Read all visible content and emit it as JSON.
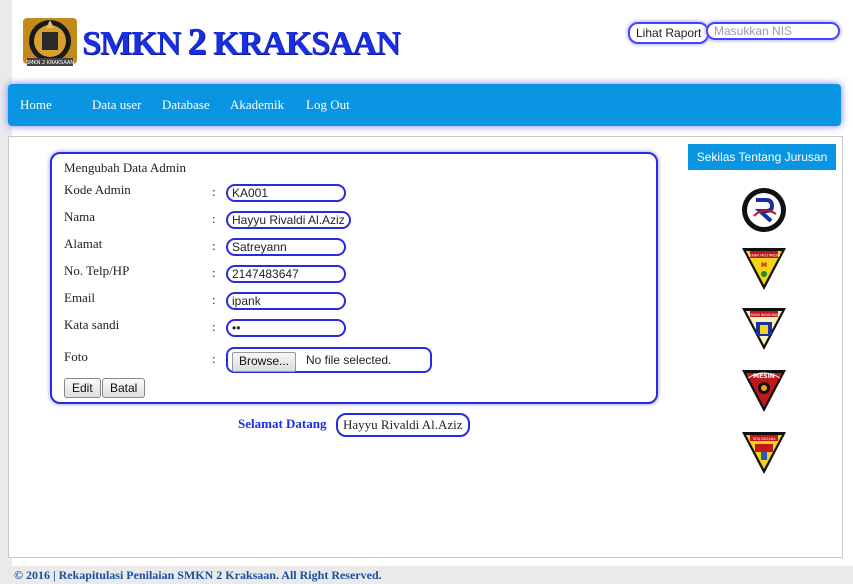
{
  "header": {
    "brand": "SMKN 2 KRAKSAAN",
    "brand_prefix": "SMKN ",
    "brand_number": "2",
    "brand_suffix": " KRAKSAAN",
    "raport_button": "Lihat Raport",
    "nis_placeholder": "Masukkan NIS"
  },
  "nav": {
    "items": [
      "Home",
      "Data user",
      "Database",
      "Akademik",
      "Log Out"
    ]
  },
  "form": {
    "title": "Mengubah Data Admin",
    "fields": [
      {
        "label": "Kode Admin",
        "value": "KA001"
      },
      {
        "label": "Nama",
        "value": "Hayyu Rivaldi Al.Aziz"
      },
      {
        "label": "Alamat",
        "value": "Satreyann"
      },
      {
        "label": "No. Telp/HP",
        "value": "2147483647"
      },
      {
        "label": "Email",
        "value": "ipank"
      },
      {
        "label": "Kata sandi",
        "value": "••"
      },
      {
        "label": "Foto",
        "value": ""
      }
    ],
    "colon": ":",
    "browse_label": "Browse...",
    "file_status": "No file selected.",
    "edit_label": "Edit",
    "cancel_label": "Batal"
  },
  "welcome": {
    "label": "Selamat Datang",
    "name": "Hayyu Rivaldi Al.Aziz"
  },
  "sidebar": {
    "title": "Sekilas Tentang Jurusan",
    "emblems": [
      "rpl-emblem",
      "multimedia-emblem",
      "bangunan-emblem",
      "mesin-emblem",
      "tata-busana-emblem"
    ],
    "emblem_texts": [
      "TEKNIK MULTIMEDIA",
      "TEKNIK BANGUNAN",
      "MESIN",
      "TATA BUSANA"
    ]
  },
  "footer": {
    "text": "© 2016 | Rekapitulasi Penilaian SMKN 2 Kraksaan. All Right Reserved."
  },
  "colors": {
    "accent": "#0a95e2",
    "brand_blue": "#1a2fe0",
    "border_blue": "#2a2ae0"
  }
}
